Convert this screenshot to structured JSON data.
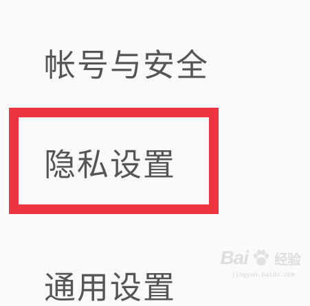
{
  "menu": {
    "items": [
      {
        "label": "帐号与安全"
      },
      {
        "label": "隐私设置"
      },
      {
        "label": "通用设置"
      }
    ]
  },
  "highlight": {
    "color": "#ee3440"
  },
  "watermark": {
    "brand": "Bai",
    "brand_suffix": "经验",
    "url": "jingyan.baidu.com",
    "icon": "paw-icon"
  }
}
